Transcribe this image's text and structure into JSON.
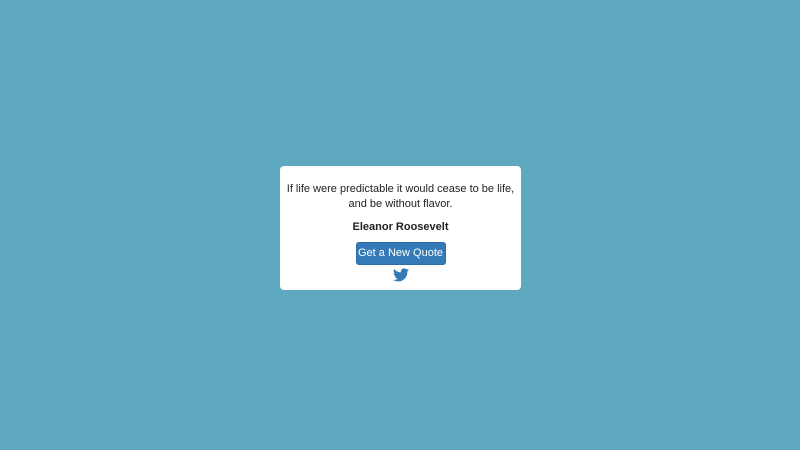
{
  "quote": {
    "lines": [
      "If life were predictable it would cease to be life,",
      "and be without flavor."
    ],
    "author": "Eleanor Roosevelt"
  },
  "actions": {
    "new_quote_label": "Get a New Quote",
    "tweet_icon": "twitter-bird-icon"
  },
  "colors": {
    "background": "#5fa9c0",
    "button": "#337ab7",
    "twitter": "#337ab7"
  }
}
